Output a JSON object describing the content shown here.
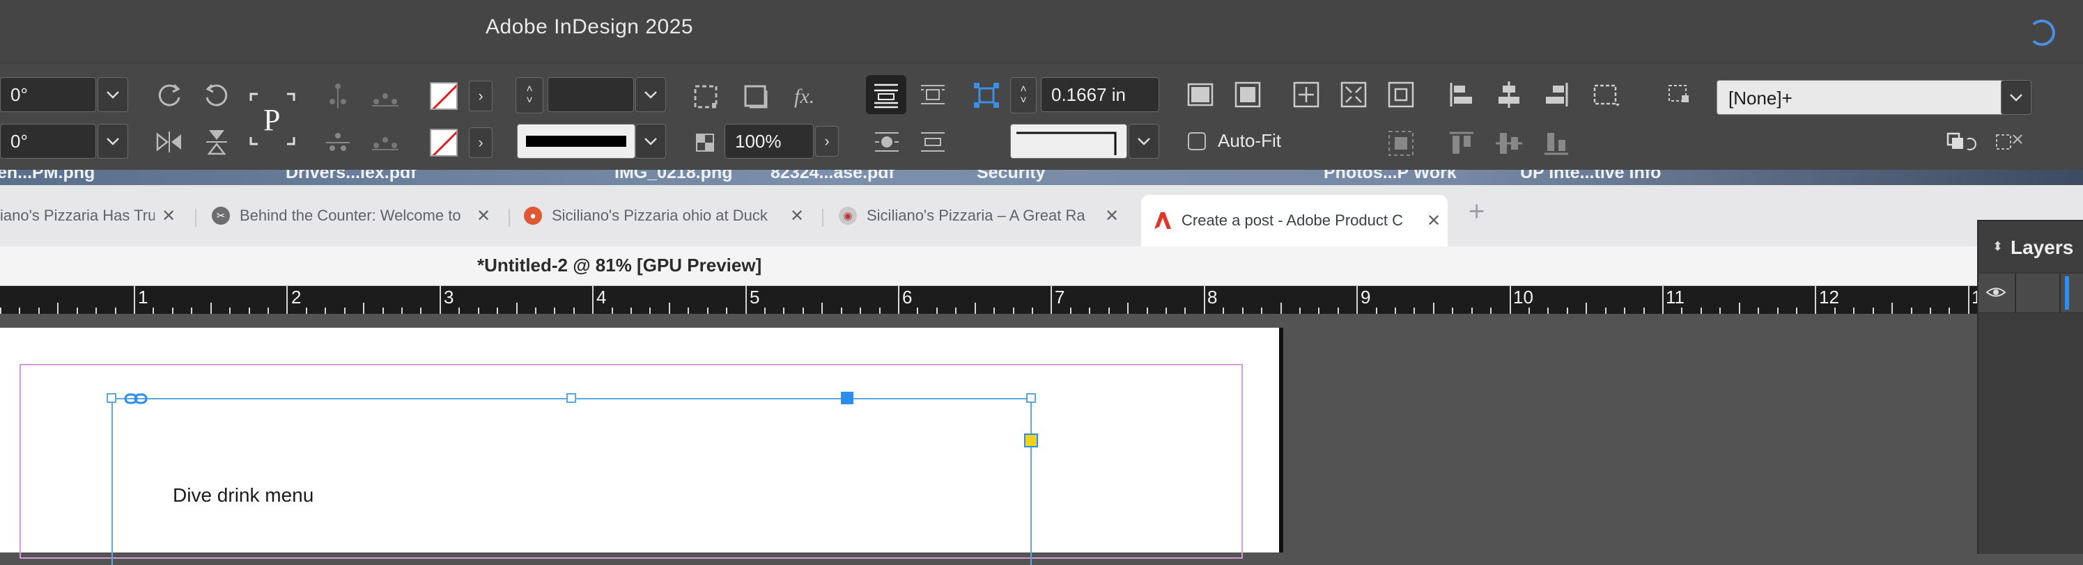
{
  "window": {
    "app_title": "Adobe InDesign 2025"
  },
  "control_panel": {
    "rotate_angle": "0°",
    "shear_angle": "0°",
    "stroke_weight": "",
    "opacity": "100%",
    "offset_value": "0.1667 in",
    "autofit_label": "Auto-Fit",
    "object_style": "[None]+"
  },
  "desktop_files": [
    "en...PM.png",
    "Drivers...lex.pdf",
    "IMG_0218.png",
    "82324...ase.pdf",
    "Security",
    "Photos...P Work",
    "UP Inte...tive Info"
  ],
  "browser_tabs": [
    {
      "title": "iano's Pizzaria Has Tru",
      "active": false
    },
    {
      "title": "Behind the Counter: Welcome to",
      "active": false
    },
    {
      "title": "Siciliano's Pizzaria ohio at Duck",
      "active": false
    },
    {
      "title": "Siciliano's Pizzaria – A Great Ra",
      "active": false
    },
    {
      "title": "Create a post - Adobe Product C",
      "active": true
    }
  ],
  "document": {
    "tab_title": "*Untitled-2 @ 81% [GPU Preview]",
    "ruler_numbers": [
      "1",
      "2",
      "3",
      "4",
      "5",
      "6",
      "7",
      "8",
      "9",
      "10",
      "11",
      "12",
      "1"
    ],
    "frame_text": "Dive drink menu"
  },
  "layers_panel": {
    "title": "Layers"
  },
  "colors": {
    "title_bar": "#454545",
    "control_panel": "#474747",
    "accent_blue": "#2b8ef0",
    "margin_guide": "#d49ad4",
    "adobe_red": "#e0342c"
  }
}
